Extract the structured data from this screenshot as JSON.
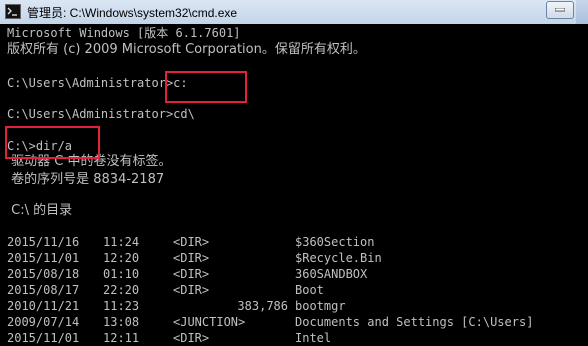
{
  "window": {
    "title": "管理员: C:\\Windows\\system32\\cmd.exe",
    "icon": "cmd-prompt-icon"
  },
  "console": {
    "header_line1": "Microsoft Windows [版本 6.1.7601]",
    "header_line2": "版权所有 (c) 2009 Microsoft Corporation。保留所有权利。",
    "prompt1": "C:\\Users\\Administrator>c:",
    "prompt2": "C:\\Users\\Administrator>cd\\",
    "prompt3": "C:\\>dir/a",
    "volume_label": " 驱动器 C 中的卷没有标签。",
    "volume_serial": " 卷的序列号是 8834-2187",
    "dir_header": " C:\\ 的目录",
    "entries": [
      {
        "date": "2015/11/16",
        "time": "11:24",
        "type": "<DIR>",
        "size": "",
        "name": "$360Section"
      },
      {
        "date": "2015/11/01",
        "time": "12:20",
        "type": "<DIR>",
        "size": "",
        "name": "$Recycle.Bin"
      },
      {
        "date": "2015/08/18",
        "time": "01:10",
        "type": "<DIR>",
        "size": "",
        "name": "360SANDBOX"
      },
      {
        "date": "2015/08/17",
        "time": "22:20",
        "type": "<DIR>",
        "size": "",
        "name": "Boot"
      },
      {
        "date": "2010/11/21",
        "time": "11:23",
        "type": "",
        "size": "383,786",
        "name": "bootmgr"
      },
      {
        "date": "2009/07/14",
        "time": "13:08",
        "type": "<JUNCTION>",
        "size": "",
        "name": "Documents and Settings [C:\\Users]"
      },
      {
        "date": "2015/11/01",
        "time": "12:11",
        "type": "<DIR>",
        "size": "",
        "name": "Intel"
      }
    ]
  },
  "colors": {
    "console_bg": "#000000",
    "console_text": "#c0c0c0",
    "highlight": "#e3213a"
  }
}
